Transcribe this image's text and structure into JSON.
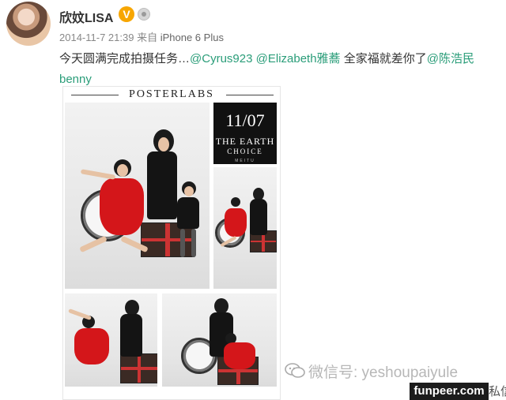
{
  "post": {
    "username": "欣妏LISA",
    "verified_badge": "V",
    "timestamp": "2014-11-7 21:39",
    "source_prefix": "来自",
    "device": "iPhone 6 Plus",
    "text_lead": "今天圆满完成拍摄任务…",
    "mentions": [
      "@Cyrus923",
      "@Elizabeth雅蕎",
      "@陈浩民"
    ],
    "text_mid": "全家福就差你了",
    "mention_tail": "benny"
  },
  "card": {
    "brand": "POSTERLABS",
    "date": "11/07",
    "line1": "THE EARTH",
    "line2": "CHOICE",
    "line3": "MEITU"
  },
  "watermark": {
    "wechat_text": "微信号: yeshoupaiyule",
    "site": "funpeer.com",
    "private_msg": "私信"
  },
  "icons": [
    "avatar",
    "verified-v-icon",
    "member-icon",
    "wechat-icon"
  ],
  "colors": {
    "mention": "#2a9d79",
    "badge": "#f7a600",
    "dress": "#d4161a"
  }
}
